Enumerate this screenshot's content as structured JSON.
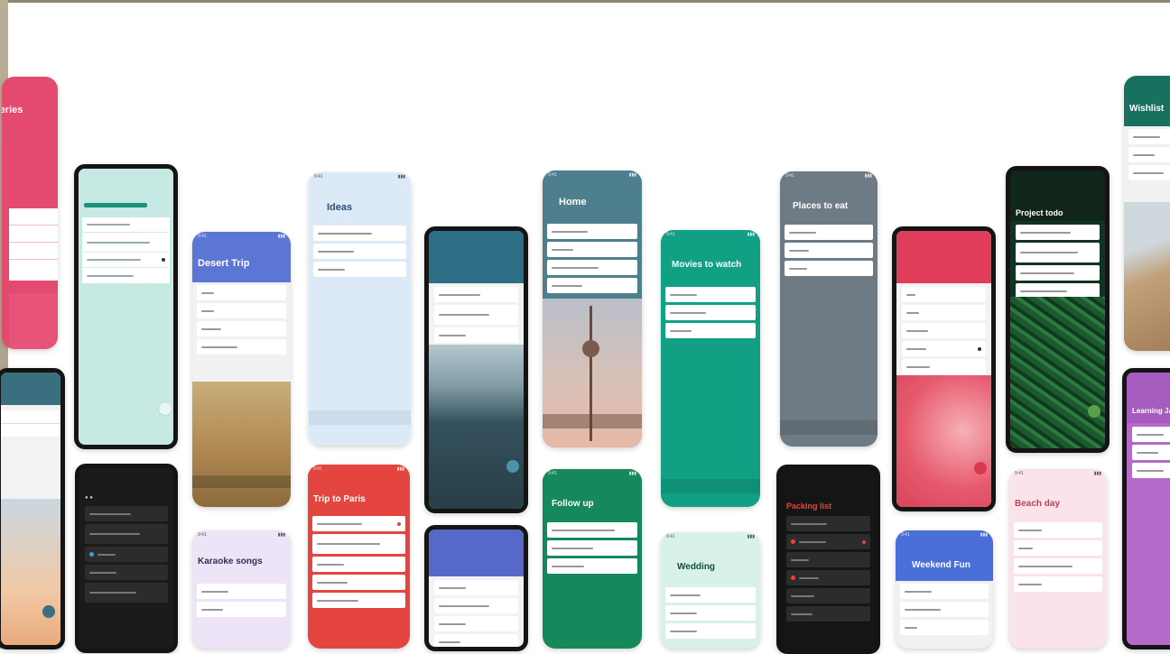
{
  "phones": [
    {
      "title": "Desert Trip",
      "color": "#4b6fd8"
    },
    {
      "title": "Ideas",
      "color": "#dbeaf8"
    },
    {
      "title": "Home",
      "color": "#4e7f8d"
    },
    {
      "title": "Movies to watch",
      "color": "#11a084"
    },
    {
      "title": "Places to eat",
      "color": "#6f7b84"
    },
    {
      "title": "Karaoke songs",
      "color": "#e7dff5"
    },
    {
      "title": "Trip to Paris",
      "color": "#e4453f"
    },
    {
      "title": "Follow up",
      "color": "#15885c"
    },
    {
      "title": "Wedding",
      "color": "#d9f2e8"
    },
    {
      "title": "Packing list",
      "color": "#141414"
    },
    {
      "title": "Weekend Fun",
      "color": "#4b6fd8"
    },
    {
      "title": "Beach day",
      "color": "#fbe3ea"
    },
    {
      "title": "Project todo",
      "color": "#10261a"
    },
    {
      "title": "Wishlist",
      "color": "#18705e"
    },
    {
      "title": "Learning Japanese",
      "color": "#a55cbe"
    },
    {
      "title": "Groceries",
      "color": "#e44a6f"
    }
  ]
}
